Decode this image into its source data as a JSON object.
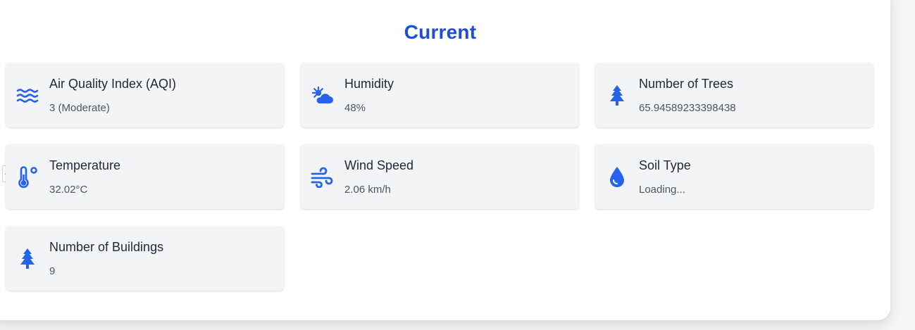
{
  "section": {
    "title": "Current"
  },
  "colors": {
    "accent": "#1d4ed8",
    "icon": "#2563eb",
    "card_bg": "#f3f4f6"
  },
  "collapse_button": {
    "glyph": "‹"
  },
  "cards": [
    {
      "icon": "waves-icon",
      "label": "Air Quality Index (AQI)",
      "value": "3 (Moderate)"
    },
    {
      "icon": "sun-cloud-icon",
      "label": "Humidity",
      "value": "48%"
    },
    {
      "icon": "tree-icon",
      "label": "Number of Trees",
      "value": "65.94589233398438"
    },
    {
      "icon": "thermometer-icon",
      "label": "Temperature",
      "value": "32.02°C"
    },
    {
      "icon": "wind-icon",
      "label": "Wind Speed",
      "value": "2.06 km/h"
    },
    {
      "icon": "droplet-icon",
      "label": "Soil Type",
      "value": "Loading..."
    },
    {
      "icon": "tree-icon",
      "label": "Number of Buildings",
      "value": "9"
    }
  ]
}
